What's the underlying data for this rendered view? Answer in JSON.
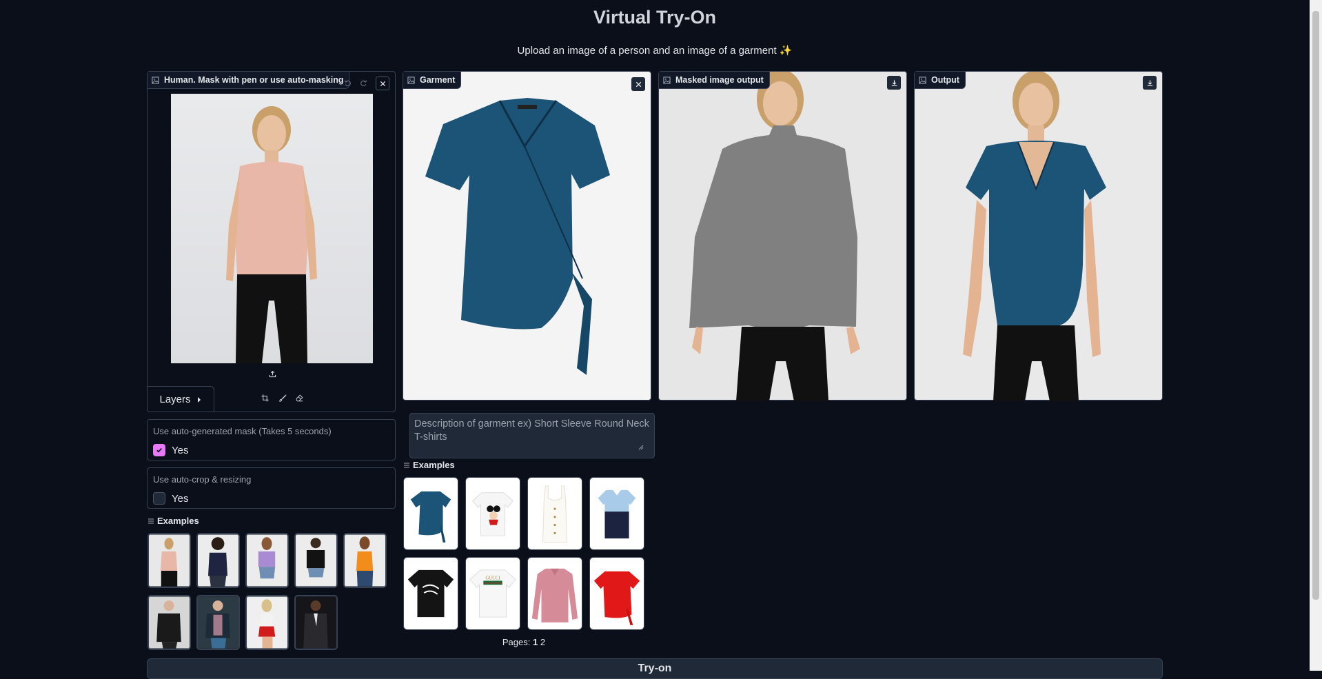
{
  "header": {
    "title": "Virtual Try-On",
    "subtitle": "Upload an image of a person and an image of a garment ✨"
  },
  "human_panel": {
    "label": "Human. Mask with pen or use auto-masking",
    "layers_label": "Layers",
    "icons": [
      "image-icon",
      "undo-icon",
      "redo-icon",
      "close-icon",
      "upload-icon",
      "crop-icon",
      "brush-icon",
      "eraser-icon"
    ]
  },
  "garment_panel": {
    "label": "Garment"
  },
  "masked_panel": {
    "label": "Masked image output"
  },
  "output_panel": {
    "label": "Output"
  },
  "options": {
    "auto_mask": {
      "info": "Use auto-generated mask (Takes 5 seconds)",
      "choice": "Yes",
      "checked": true
    },
    "auto_crop": {
      "info": "Use auto-crop & resizing",
      "choice": "Yes",
      "checked": false
    }
  },
  "human_examples": {
    "title": "Examples",
    "count": 9
  },
  "garment_description": {
    "placeholder": "Description of garment ex) Short Sleeve Round Neck T-shirts"
  },
  "garment_examples": {
    "title": "Examples",
    "pages_label": "Pages:",
    "current_page": "1",
    "other_page": "2",
    "items": [
      "blue velvet wrap top",
      "white Minnie Mouse t-shirt",
      "white buttoned camisole",
      "navy and light blue polo",
      "black Stüssy t-shirt",
      "white GUCCI t-shirt",
      "pink long sleeve shirt",
      "red tie-waist t-shirt"
    ]
  },
  "submit": {
    "label": "Try-on"
  },
  "colors": {
    "background": "#0b0f19",
    "accent": "#e879f9",
    "border": "#374151",
    "garment_blue": "#1c5478"
  }
}
